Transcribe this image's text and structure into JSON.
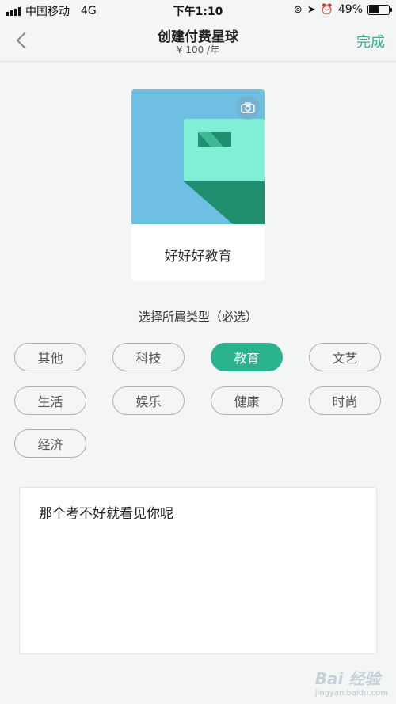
{
  "status_bar": {
    "carrier": "中国移动",
    "network": "4G",
    "time": "下午1:10",
    "battery": "49%",
    "battery_level": 0.49
  },
  "nav": {
    "title": "创建付费星球",
    "subtitle": "¥ 100 /年",
    "done_label": "完成"
  },
  "card": {
    "name": "好好好教育"
  },
  "type_section": {
    "title": "选择所属类型（必选）",
    "tags": [
      {
        "label": "其他",
        "selected": false
      },
      {
        "label": "科技",
        "selected": false
      },
      {
        "label": "教育",
        "selected": true
      },
      {
        "label": "文艺",
        "selected": false
      },
      {
        "label": "生活",
        "selected": false
      },
      {
        "label": "娱乐",
        "selected": false
      },
      {
        "label": "健康",
        "selected": false
      },
      {
        "label": "时尚",
        "selected": false
      },
      {
        "label": "经济",
        "selected": false
      }
    ]
  },
  "description": {
    "text": "那个考不好就看见你呢"
  },
  "watermark": {
    "brand": "Bai 经验",
    "url": "jingyan.baidu.com"
  },
  "colors": {
    "accent": "#2bb28f",
    "cover_bg": "#6fbfe3",
    "page_bg": "#f4f6f5"
  }
}
